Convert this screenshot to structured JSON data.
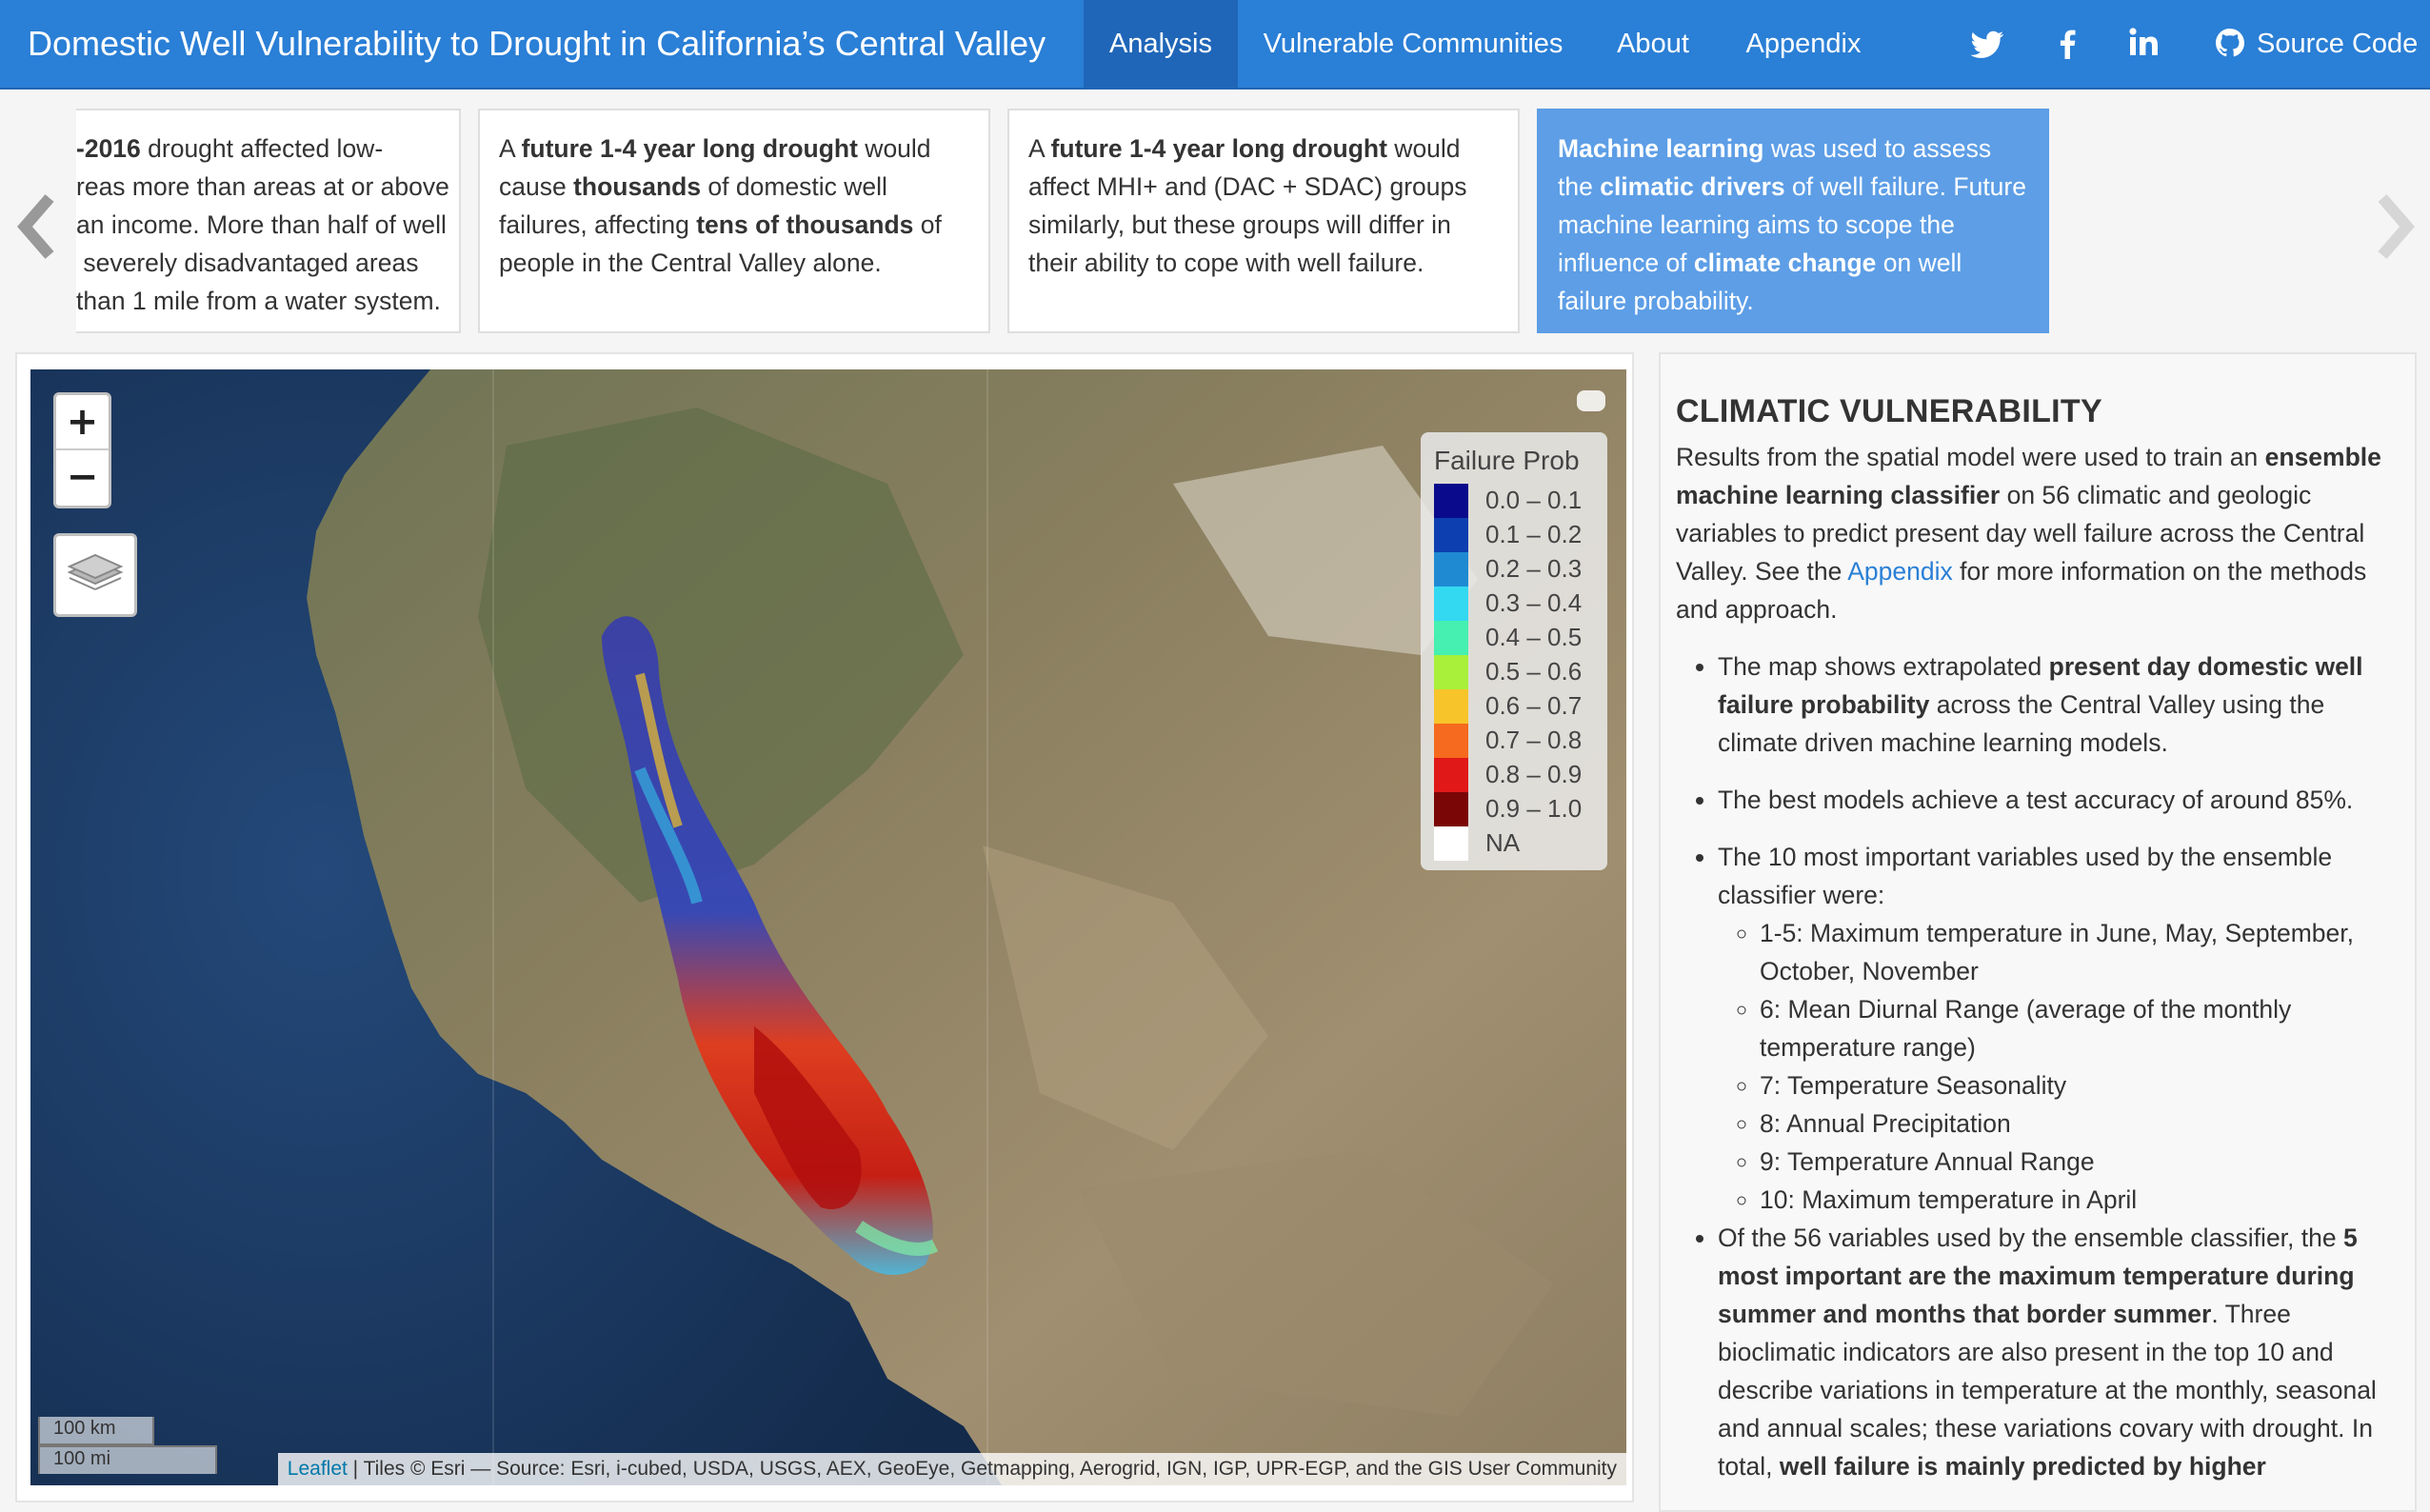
{
  "nav": {
    "title": "Domestic Well Vulnerability to Drought in California’s Central Valley",
    "tabs": [
      "Analysis",
      "Vulnerable Communities",
      "About",
      "Appendix"
    ],
    "active_tab": "Analysis",
    "social": [
      "twitter-icon",
      "facebook-icon",
      "linkedin-icon",
      "github-icon"
    ],
    "source_code": "Source Code"
  },
  "cards": {
    "card1": {
      "line1_bold": "-2016",
      "line1_rest": " drought affected low-",
      "line2": "reas more than areas at or above",
      "line3": "an income. More than half of well",
      "line4": " severely disadvantaged areas",
      "line5": "than 1 mile from a water system."
    },
    "card2": {
      "p1": "A ",
      "b1": "future 1-4 year long drought",
      "p2": " would cause ",
      "b2": "thousands",
      "p3": " of domestic well failures, affecting ",
      "b3": "tens of thousands",
      "p4": " of people in the Central Valley alone."
    },
    "card3": {
      "p1": "A ",
      "b1": "future 1-4 year long drought",
      "p2": " would affect MHI+ and (DAC + SDAC) groups similarly, but these groups will differ in their ability to cope with well failure."
    },
    "card4": {
      "b1": "Machine learning",
      "p1": " was used to assess the ",
      "b2": "climatic drivers",
      "p2": " of well failure. Future machine learning aims to scope the influence of ",
      "b3": "climate change",
      "p3": " on well failure probability."
    }
  },
  "map": {
    "zoom_in": "+",
    "zoom_out": "−",
    "legend_title": "Failure Prob",
    "legend": [
      {
        "label": "0.0 – 0.1",
        "color": "#0a0a8c"
      },
      {
        "label": "0.1 – 0.2",
        "color": "#0d3fb0"
      },
      {
        "label": "0.2 – 0.3",
        "color": "#1f8ad2"
      },
      {
        "label": "0.3 – 0.4",
        "color": "#33d9f0"
      },
      {
        "label": "0.4 – 0.5",
        "color": "#45f0b0"
      },
      {
        "label": "0.5 – 0.6",
        "color": "#a8f03a"
      },
      {
        "label": "0.6 – 0.7",
        "color": "#f7c42a"
      },
      {
        "label": "0.7 – 0.8",
        "color": "#f56a1e"
      },
      {
        "label": "0.8 – 0.9",
        "color": "#e01818"
      },
      {
        "label": "0.9 – 1.0",
        "color": "#7a0606"
      },
      {
        "label": "NA",
        "color": "#ffffff"
      }
    ],
    "scale_km": "100 km",
    "scale_mi": "100 mi",
    "attribution_link": "Leaflet",
    "attribution_text": " | Tiles © Esri — Source: Esri, i-cubed, USDA, USGS, AEX, GeoEye, Getmapping, Aerogrid, IGN, IGP, UPR-EGP, and the GIS User Community"
  },
  "side": {
    "heading": "CLIMATIC VULNERABILITY",
    "intro_1": "Results from the spatial model were used to train an ",
    "intro_b": "ensemble machine learning classifier",
    "intro_2": " on 56 climatic and geologic variables to predict present day well failure across the Central Valley. See the ",
    "intro_link": "Appendix",
    "intro_3": " for more information on the methods and approach.",
    "b1_1": "The map shows extrapolated ",
    "b1_b": "present day domestic well failure probability",
    "b1_2": " across the Central Valley using the climate driven machine learning models.",
    "b2": "The best models achieve a test accuracy of around 85%.",
    "b3": "The 10 most important variables used by the ensemble classifier were:",
    "sub": [
      "1-5: Maximum temperature in June, May, September, October, November",
      "6: Mean Diurnal Range (average of the monthly temperature range)",
      "7: Temperature Seasonality",
      "8: Annual Precipitation",
      "9: Temperature Annual Range",
      "10: Maximum temperature in April"
    ],
    "b4_1": "Of the 56 variables used by the ensemble classifier, the ",
    "b4_b1": "5 most important are the maximum temperature during summer and months that border summer",
    "b4_2": ". Three bioclimatic indicators are also present in the top 10 and describe variations in temperature at the monthly, seasonal and annual scales; these variations covary with drought. In total, ",
    "b4_b2": "well failure is mainly predicted by higher"
  }
}
